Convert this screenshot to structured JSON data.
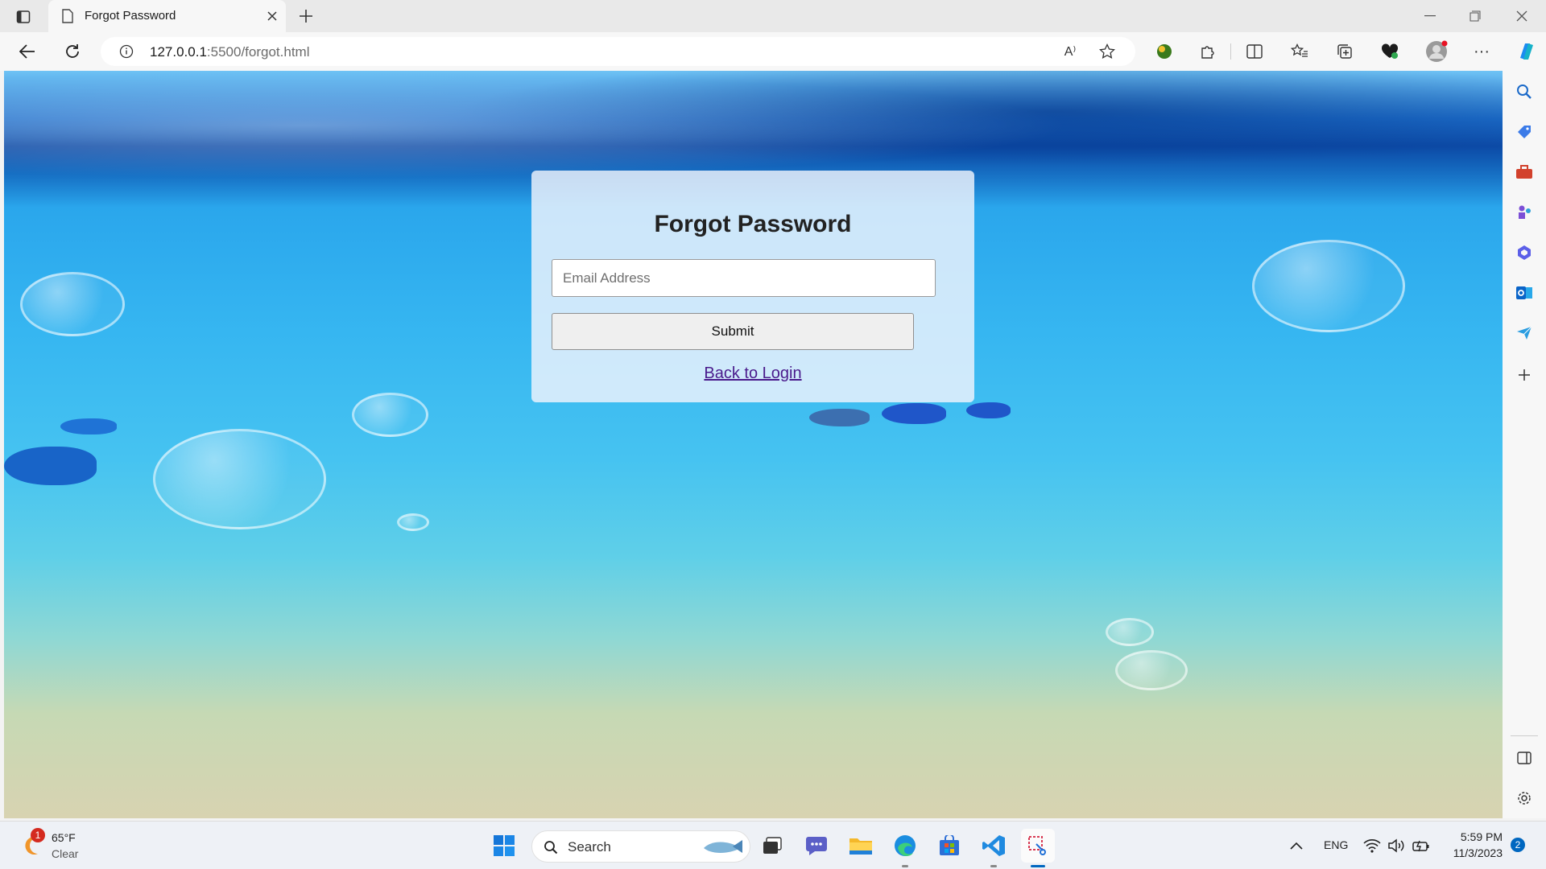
{
  "browser": {
    "tab_title": "Forgot Password",
    "url_host": "127.0.0.1",
    "url_path": ":5500/forgot.html",
    "read_aloud_label": "A⁾"
  },
  "form": {
    "title": "Forgot Password",
    "email_placeholder": "Email Address",
    "email_value": "",
    "submit_label": "Submit",
    "back_link": "Back to Login"
  },
  "taskbar": {
    "weather_temp": "65°F",
    "weather_desc": "Clear",
    "weather_badge": "1",
    "search_label": "Search",
    "lang": "ENG",
    "time": "5:59 PM",
    "date": "11/3/2023",
    "notification_count": "2"
  },
  "colors": {
    "accent": "#0078d4",
    "link_visited": "#4a1a8c"
  }
}
